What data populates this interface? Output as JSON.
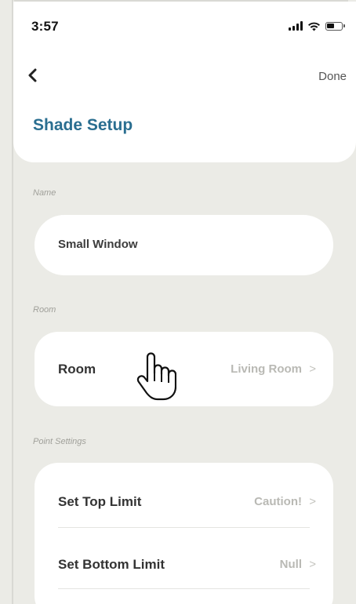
{
  "status_bar": {
    "time": "3:57",
    "icons": [
      "signal-icon",
      "wifi-icon",
      "battery-icon"
    ]
  },
  "nav": {
    "back_icon": "chevron-left-icon",
    "done_label": "Done"
  },
  "page": {
    "title": "Shade Setup"
  },
  "sections": {
    "name": {
      "label": "Name",
      "value": "Small Window"
    },
    "room": {
      "label": "Room",
      "row_label": "Room",
      "row_value": "Living Room",
      "chevron": ">"
    },
    "point_settings": {
      "label": "Point Settings",
      "rows": [
        {
          "label": "Set Top Limit",
          "value": "Caution!",
          "chevron": ">"
        },
        {
          "label": "Set Bottom Limit",
          "value": "Null",
          "chevron": ">"
        }
      ]
    }
  },
  "cursor": {
    "icon": "hand-pointer-icon"
  },
  "colors": {
    "background": "#ebebe6",
    "card": "#ffffff",
    "title_accent": "#2a6e90",
    "value_muted": "#b9b9b4"
  }
}
